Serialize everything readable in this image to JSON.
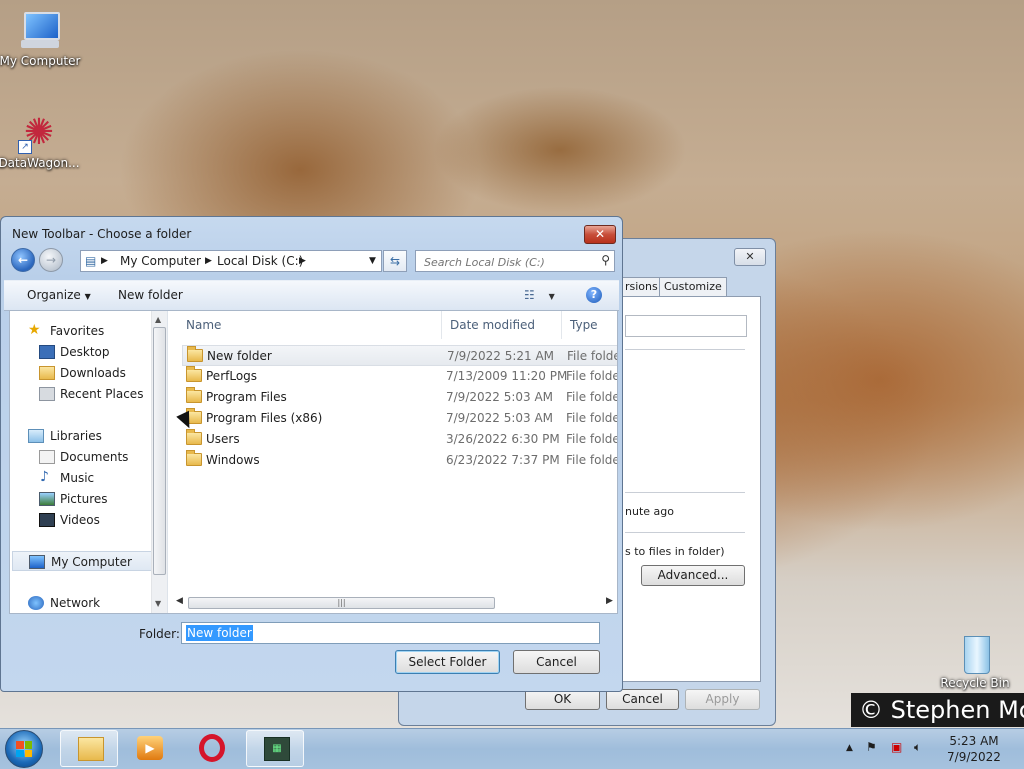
{
  "desktop": {
    "icons": [
      {
        "label": "My Computer"
      },
      {
        "label": "DataWagon..."
      },
      {
        "label": "Recycle Bin"
      }
    ],
    "watermark": "© Stephen Mc"
  },
  "background_window": {
    "close_glyph": "✕",
    "tabs": [
      "rsions",
      "Customize"
    ],
    "text_modified": "nute ago",
    "text_apply": "s to files in folder)",
    "advanced_button": "Advanced...",
    "ok_button": "OK",
    "cancel_button": "Cancel",
    "apply_button": "Apply"
  },
  "dialog": {
    "title": "New Toolbar - Choose a folder",
    "close_glyph": "✕",
    "breadcrumb": [
      "My Computer",
      "Local Disk (C:)"
    ],
    "search_placeholder": "Search Local Disk (C:)",
    "toolbar": {
      "organize": "Organize",
      "new_folder": "New folder"
    },
    "nav": {
      "favorites": {
        "label": "Favorites",
        "items": [
          "Desktop",
          "Downloads",
          "Recent Places"
        ]
      },
      "libraries": {
        "label": "Libraries",
        "items": [
          "Documents",
          "Music",
          "Pictures",
          "Videos"
        ]
      },
      "computer": "My Computer",
      "network": "Network"
    },
    "columns": [
      "Name",
      "Date modified",
      "Type"
    ],
    "files": [
      {
        "name": "New folder",
        "date": "7/9/2022 5:21 AM",
        "type": "File folder"
      },
      {
        "name": "PerfLogs",
        "date": "7/13/2009 11:20 PM",
        "type": "File folder"
      },
      {
        "name": "Program Files",
        "date": "7/9/2022 5:03 AM",
        "type": "File folder"
      },
      {
        "name": "Program Files (x86)",
        "date": "7/9/2022 5:03 AM",
        "type": "File folder"
      },
      {
        "name": "Users",
        "date": "3/26/2022 6:30 PM",
        "type": "File folder"
      },
      {
        "name": "Windows",
        "date": "6/23/2022 7:37 PM",
        "type": "File folder"
      }
    ],
    "folder_label": "Folder:",
    "folder_value": "New folder",
    "select_button": "Select Folder",
    "cancel_button": "Cancel"
  },
  "taskbar": {
    "apps": [
      "windows-explorer",
      "media-player",
      "opera",
      "datawagon"
    ],
    "time": "5:23 AM",
    "date": "7/9/2022"
  },
  "colors": {
    "accent": "#3399ff",
    "close_red": "#c74e3a"
  }
}
